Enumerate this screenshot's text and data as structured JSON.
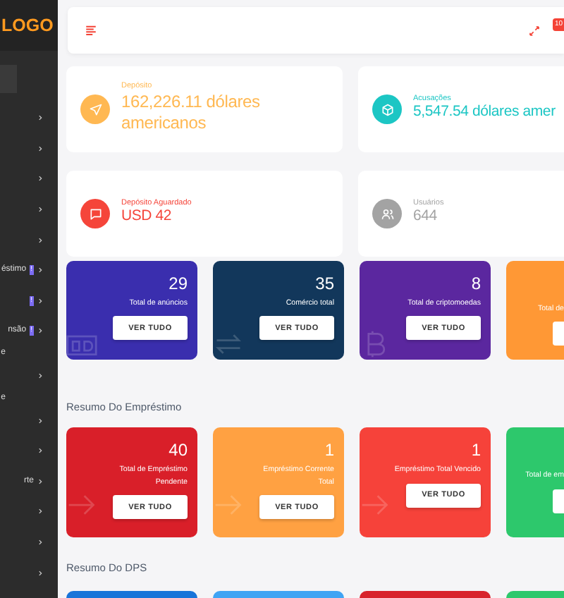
{
  "sidebar": {
    "logo": "LOGO",
    "items": [
      {
        "kind": "active"
      },
      {
        "kind": "link"
      },
      {
        "kind": "link"
      },
      {
        "kind": "link"
      },
      {
        "kind": "link"
      },
      {
        "kind": "link"
      },
      {
        "kind": "link",
        "label": "éstimo",
        "badge": "!"
      },
      {
        "kind": "link",
        "badge": "!"
      },
      {
        "kind": "link",
        "label": "nsão",
        "badge": "!"
      },
      {
        "kind": "header",
        "label": "e"
      },
      {
        "kind": "link"
      },
      {
        "kind": "header",
        "label": "e"
      },
      {
        "kind": "link"
      },
      {
        "kind": "link"
      },
      {
        "kind": "link",
        "label": "rte"
      },
      {
        "kind": "link"
      },
      {
        "kind": "link"
      },
      {
        "kind": "link"
      }
    ]
  },
  "topbar": {
    "badge": "10"
  },
  "stats": [
    {
      "label": "Depósito",
      "value": "162,226.11 dólares americanos",
      "color": "#ffb852"
    },
    {
      "label": "Acusações",
      "value": "5,547.54 dólares amer",
      "color": "#1cc6c4"
    },
    {
      "label": "Depósito Aguardado",
      "value": "USD 42",
      "color": "#f5453a"
    },
    {
      "label": "Usuários",
      "value": "644",
      "color": "#a3a3a3"
    }
  ],
  "summary_cards": [
    {
      "kind": "full",
      "number": "29",
      "label": "Total de anúncios",
      "button": "VER TUDO",
      "color": "#3a2eae"
    },
    {
      "kind": "full",
      "number": "35",
      "label": "Comércio total",
      "button": "VER TUDO",
      "color": "#12375b"
    },
    {
      "kind": "full",
      "number": "8",
      "label": "Total de criptomoedas",
      "button": "VER TUDO",
      "color": "#5b279f"
    },
    {
      "kind": "cut",
      "label": "Total de",
      "color": "#ff9835"
    }
  ],
  "sections": [
    {
      "title": "Resumo Do Empréstimo",
      "cards": [
        {
          "kind": "full",
          "number": "40",
          "label": "Total de Empréstimo Pendente",
          "button": "VER TUDO",
          "color": "#d91f29"
        },
        {
          "kind": "full",
          "number": "1",
          "label": "Empréstimo Corrente Total",
          "button": "VER TUDO",
          "color": "#ffa142"
        },
        {
          "kind": "full",
          "number": "1",
          "label": "Empréstimo Total Vencido",
          "button": "VER TUDO",
          "color": "#f6423a"
        },
        {
          "kind": "cut",
          "label": "Total de em",
          "color": "#2dc86c"
        }
      ]
    },
    {
      "title": "Resumo Do DPS",
      "cards": [
        {
          "kind": "full",
          "color": "#1874d9"
        },
        {
          "kind": "full",
          "color": "#40a4f4"
        },
        {
          "kind": "full",
          "color": "#d8232c"
        },
        {
          "kind": "cut",
          "color": "#2dc86c"
        }
      ]
    }
  ]
}
